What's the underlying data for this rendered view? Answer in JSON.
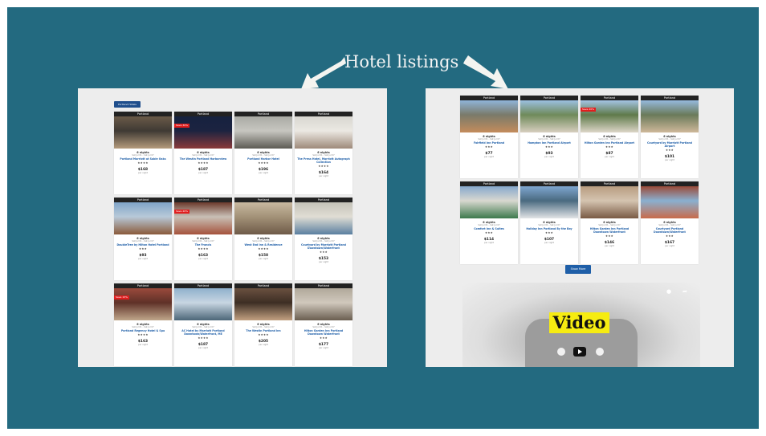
{
  "slide": {
    "heading": "Hotel listings"
  },
  "left_page": {
    "button_label": "Portland Hotels",
    "cards": [
      {
        "city": "Portland",
        "badge": "",
        "nights": "6 nights",
        "dates": "Sat Jul 01 - Sat Jul 07",
        "name": "Portland Marriott at Sable Oaks",
        "stars": "★★★★",
        "price": "$168",
        "per": "per night",
        "img": [
          "#6a5a48",
          "#b49a7c",
          "#3f3a34"
        ]
      },
      {
        "city": "Portland",
        "badge": "Save 30%",
        "nights": "6 nights",
        "dates": "Sat Jul 01 - Sat Jul 07",
        "name": "The Westin Portland Harborview",
        "stars": "★★★★",
        "price": "$187",
        "per": "per night",
        "img": [
          "#16223f",
          "#8a3a3a",
          "#1c2340"
        ]
      },
      {
        "city": "Portland",
        "badge": "",
        "nights": "6 nights",
        "dates": "Sat Jul 01 - Sat Jul 07",
        "name": "Portland Harbor Hotel",
        "stars": "★★★★",
        "price": "$196",
        "per": "per night",
        "img": [
          "#a9aaa4",
          "#5d5b54",
          "#c7c6c0"
        ]
      },
      {
        "city": "Portland",
        "badge": "",
        "nights": "6 nights",
        "dates": "Sat Jul 01 - Sat Jul 07",
        "name": "The Press Hotel, Marriott Autograph Collection",
        "stars": "★★★★",
        "price": "$164",
        "per": "per night",
        "img": [
          "#d8d6d0",
          "#9e8a7a",
          "#ebe8e2"
        ]
      },
      {
        "city": "Portland",
        "badge": "",
        "nights": "6 nights",
        "dates": "Sat Jul 01 - Sat Jul 07",
        "name": "DoubleTree by Hilton Hotel Portland",
        "stars": "★★★",
        "price": "$93",
        "per": "per night",
        "img": [
          "#7fa4c8",
          "#8a5a3a",
          "#b8c9d8"
        ]
      },
      {
        "city": "Portland",
        "badge": "Save 20%",
        "nights": "6 nights",
        "dates": "Sat Jul 01 - Sat Jul 07",
        "name": "The Francis",
        "stars": "★★★★",
        "price": "$163",
        "per": "per night",
        "img": [
          "#6b3a2c",
          "#a5533c",
          "#c9c0b6"
        ]
      },
      {
        "city": "Portland",
        "badge": "",
        "nights": "6 nights",
        "dates": "Sat Jul 01 - Sat Jul 07",
        "name": "West End Inn & Residence",
        "stars": "★★★★",
        "price": "$158",
        "per": "per night",
        "img": [
          "#c8b8a0",
          "#6e5a48",
          "#a39278"
        ]
      },
      {
        "city": "Portland",
        "badge": "",
        "nights": "6 nights",
        "dates": "Sat Jul 01 - Sat Jul 07",
        "name": "Courtyard by Marriott Portland Downtown/Waterfront",
        "stars": "★★★",
        "price": "$153",
        "per": "per night",
        "img": [
          "#c4c2b8",
          "#5a7fa0",
          "#e0ddd4"
        ]
      },
      {
        "city": "Portland",
        "badge": "Save 15%",
        "nights": "6 nights",
        "dates": "Sat Jul 01 - Sat Jul 07",
        "name": "Portland Regency Hotel & Spa",
        "stars": "★★★★",
        "price": "$163",
        "per": "per night",
        "img": [
          "#9a4a3c",
          "#bfa68a",
          "#5f3128"
        ]
      },
      {
        "city": "Portland",
        "badge": "",
        "nights": "6 nights",
        "dates": "Sat Jul 01 - Sat Jul 07",
        "name": "AC Hotel by Marriott Portland Downtown/Waterfront, ME",
        "stars": "★★★★",
        "price": "$187",
        "per": "per night",
        "img": [
          "#8fb0cc",
          "#4c6678",
          "#c8d6e2"
        ]
      },
      {
        "city": "Portland",
        "badge": "",
        "nights": "6 nights",
        "dates": "Sat Jul 01 - Sat Jul 07",
        "name": "The Westin Portland Inn",
        "stars": "★★★★",
        "price": "$205",
        "per": "per night",
        "img": [
          "#6a5140",
          "#c2a080",
          "#3d2e24"
        ]
      },
      {
        "city": "Portland",
        "badge": "",
        "nights": "6 nights",
        "dates": "Sat Jul 01 - Sat Jul 07",
        "name": "Hilton Garden Inn Portland Downtown Waterfront",
        "stars": "★★★",
        "price": "$177",
        "per": "per night",
        "img": [
          "#b0a89a",
          "#6a5e50",
          "#d0c8bc"
        ]
      }
    ]
  },
  "right_page": {
    "cards": [
      {
        "city": "Portland",
        "badge": "",
        "nights": "6 nights",
        "dates": "Sat Jul 01 - Sat Jul 07",
        "name": "Fairfield Inn Portland",
        "stars": "★★★",
        "price": "$77",
        "per": "per night",
        "img": [
          "#8fb4d8",
          "#c48c5c",
          "#7a7a6a"
        ]
      },
      {
        "city": "Portland",
        "badge": "",
        "nights": "6 nights",
        "dates": "Sat Jul 01 - Sat Jul 07",
        "name": "Hampton Inn Portland Airport",
        "stars": "★★★",
        "price": "$93",
        "per": "per night",
        "img": [
          "#9bbfe0",
          "#d8cfc0",
          "#6f8a5a"
        ]
      },
      {
        "city": "Portland",
        "badge": "Save 20%",
        "nights": "6 nights",
        "dates": "Sat Jul 01 - Sat Jul 07",
        "name": "Hilton Garden Inn Portland Airport",
        "stars": "★★★",
        "price": "$87",
        "per": "per night",
        "img": [
          "#a4c4e4",
          "#ddd6c8",
          "#5f7a4a"
        ]
      },
      {
        "city": "Portland",
        "badge": "",
        "nights": "6 nights",
        "dates": "Sat Jul 01 - Sat Jul 07",
        "name": "Courtyard by Marriott Portland Airport",
        "stars": "★★★",
        "price": "$101",
        "per": "per night",
        "img": [
          "#95b9dd",
          "#cfb89a",
          "#6a7a5a"
        ]
      },
      {
        "city": "Portland",
        "badge": "",
        "nights": "6 nights",
        "dates": "Sat Jul 01 - Sat Jul 07",
        "name": "Comfort Inn & Suites",
        "stars": "★★★",
        "price": "$114",
        "per": "per night",
        "img": [
          "#86a8cc",
          "#3c7a4c",
          "#d8d8d0"
        ]
      },
      {
        "city": "Portland",
        "badge": "",
        "nights": "6 nights",
        "dates": "Sat Jul 01 - Sat Jul 07",
        "name": "Holiday Inn Portland By the Bay",
        "stars": "★★★",
        "price": "$107",
        "per": "per night",
        "img": [
          "#7ea6d0",
          "#e2e4e6",
          "#4a6a80"
        ]
      },
      {
        "city": "Portland",
        "badge": "",
        "nights": "6 nights",
        "dates": "Sat Jul 01 - Sat Jul 07",
        "name": "Hilton Garden Inn Portland Downtown Waterfront",
        "stars": "★★★",
        "price": "$146",
        "per": "per night",
        "img": [
          "#b89c80",
          "#7a5a44",
          "#d4c4b0"
        ]
      },
      {
        "city": "Portland",
        "badge": "",
        "nights": "6 nights",
        "dates": "Sat Jul 01 - Sat Jul 07",
        "name": "Courtyard Portland Downtown/Waterfront",
        "stars": "★★★",
        "price": "$167",
        "per": "per night",
        "img": [
          "#9a4a38",
          "#c86a4a",
          "#8ab0d0"
        ]
      }
    ],
    "more_button": "Show More",
    "video_label": "Video"
  }
}
